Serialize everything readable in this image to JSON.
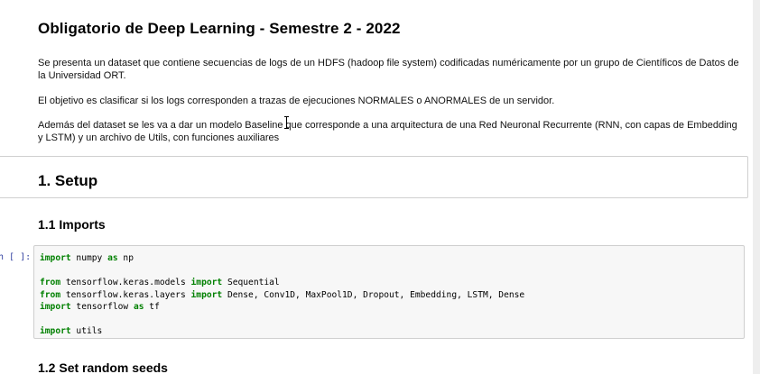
{
  "title": "Obligatorio de Deep Learning - Semestre 2 - 2022",
  "paragraphs": {
    "p1": "Se presenta un dataset que contiene secuencias de logs de un HDFS (hadoop file system) codificadas numéricamente por un grupo de Científicos de Datos de la Universidad ORT.",
    "p2": "El objetivo es clasificar si los logs corresponden a trazas de ejecuciones NORMALES o ANORMALES de un servidor.",
    "p3": "Además del dataset se les va a dar un modelo Baseline que corresponde a una arquitectura de una Red Neuronal Recurrente (RNN, con capas de Embedding y LSTM) y un archivo de Utils, con funciones auxiliares"
  },
  "section_setup": "1. Setup",
  "section_imports": "1.1 Imports",
  "section_seeds": "1.2 Set random seeds",
  "prompt": "n [ ]:",
  "code": {
    "l1_kw": "import",
    "l1_rest": " numpy ",
    "l1_kw2": "as",
    "l1_rest2": " np",
    "l2_kw": "from",
    "l2_rest": " tensorflow.keras.models ",
    "l2_kw2": "import",
    "l2_rest2": " Sequential",
    "l3_kw": "from",
    "l3_rest": " tensorflow.keras.layers ",
    "l3_kw2": "import",
    "l3_rest2": " Dense, Conv1D, MaxPool1D, Dropout, Embedding, LSTM, Dense",
    "l4_kw": "import",
    "l4_rest": " tensorflow ",
    "l4_kw2": "as",
    "l4_rest2": " tf",
    "l5_kw": "import",
    "l5_rest": " utils"
  },
  "colors": {
    "keyword": "#008000",
    "prompt": "#303f9f",
    "code_bg": "#f7f7f7",
    "border": "#cfcfcf"
  }
}
